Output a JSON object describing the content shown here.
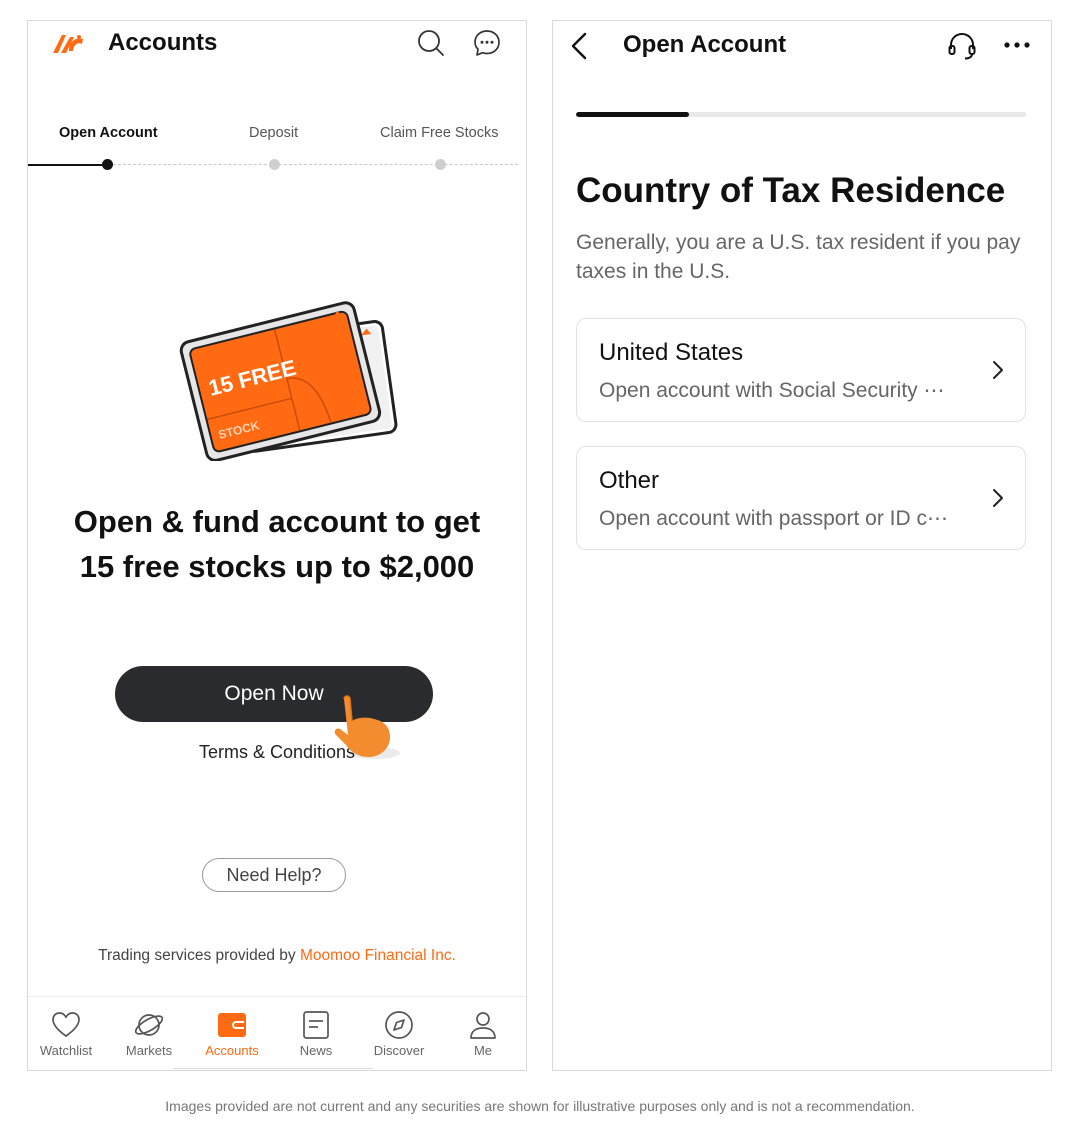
{
  "colors": {
    "accent": "#ff6a13",
    "button_dark": "#2a2b2f",
    "text": "#111111",
    "muted": "#666666"
  },
  "left_screen": {
    "header": {
      "logo_icon": "moomoo-logo-icon",
      "title": "Accounts",
      "search_icon": "search-icon",
      "chat_icon": "chat-bubble-icon"
    },
    "steps": [
      {
        "label": "Open Account",
        "state": "current"
      },
      {
        "label": "Deposit",
        "state": "pending"
      },
      {
        "label": "Claim Free Stocks",
        "state": "pending"
      }
    ],
    "promo": {
      "card_text_1": "15 FREE",
      "card_text_2": "STOCK",
      "headline_line_1": "Open & fund account to get",
      "headline_line_2": "15 free stocks up to $2,000"
    },
    "open_button_label": "Open Now",
    "terms_link": "Terms & Conditions",
    "help_button_label": "Need Help?",
    "footer": {
      "prefix": "Trading services provided by ",
      "link": "Moomoo Financial Inc."
    },
    "tabbar": [
      {
        "label": "Watchlist",
        "icon": "heart-icon",
        "active": false
      },
      {
        "label": "Markets",
        "icon": "planet-icon",
        "active": false
      },
      {
        "label": "Accounts",
        "icon": "wallet-icon",
        "active": true
      },
      {
        "label": "News",
        "icon": "news-icon",
        "active": false
      },
      {
        "label": "Discover",
        "icon": "compass-icon",
        "active": false
      },
      {
        "label": "Me",
        "icon": "person-icon",
        "active": false
      }
    ]
  },
  "right_screen": {
    "header": {
      "back_icon": "chevron-left-icon",
      "title": "Open Account",
      "support_icon": "headset-icon",
      "more_icon": "more-dots-icon"
    },
    "progress": 0.25,
    "heading": "Country of Tax Residence",
    "subtitle": "Generally, you are a U.S. tax resident if you pay taxes in the U.S.",
    "options": [
      {
        "title": "United States",
        "description": "Open account with Social Security ⋯"
      },
      {
        "title": "Other",
        "description": "Open account with passport or ID c⋯"
      }
    ]
  },
  "disclaimer": "Images provided are not current and any securities are shown for illustrative purposes only and is not a recommendation."
}
